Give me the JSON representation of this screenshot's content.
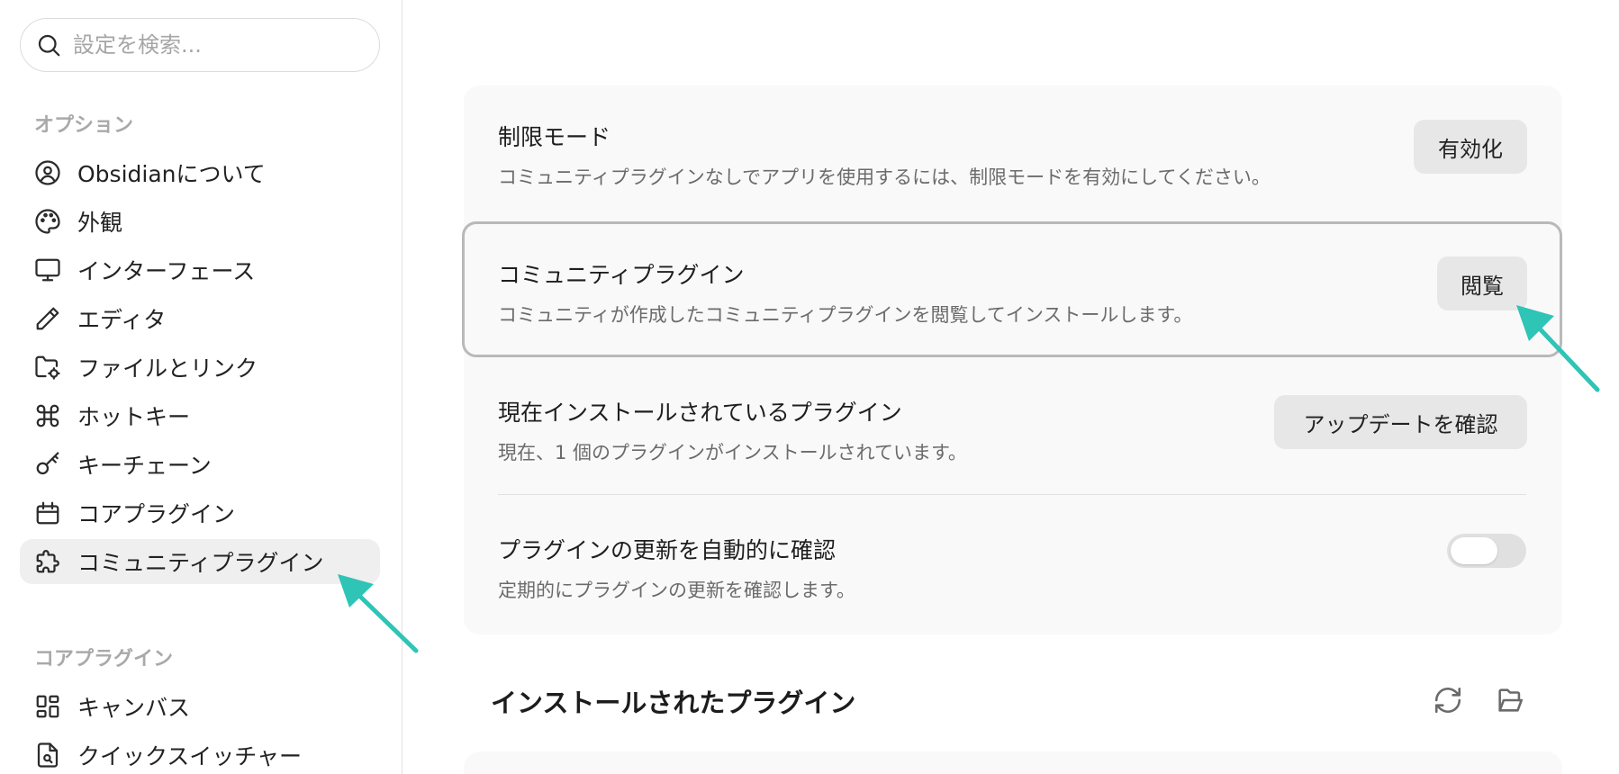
{
  "search": {
    "placeholder": "設定を検索..."
  },
  "sidebar": {
    "options_title": "オプション",
    "items": [
      {
        "label": "Obsidianについて",
        "icon": "user-circle-icon"
      },
      {
        "label": "外観",
        "icon": "palette-icon"
      },
      {
        "label": "インターフェース",
        "icon": "monitor-icon"
      },
      {
        "label": "エディタ",
        "icon": "pencil-icon"
      },
      {
        "label": "ファイルとリンク",
        "icon": "folder-cog-icon"
      },
      {
        "label": "ホットキー",
        "icon": "command-icon"
      },
      {
        "label": "キーチェーン",
        "icon": "key-icon"
      },
      {
        "label": "コアプラグイン",
        "icon": "calendar-icon"
      },
      {
        "label": "コミュニティプラグイン",
        "icon": "puzzle-icon",
        "active": true
      }
    ],
    "core_title": "コアプラグイン",
    "core_items": [
      {
        "label": "キャンバス",
        "icon": "layout-dashboard-icon"
      },
      {
        "label": "クイックスイッチャー",
        "icon": "file-search-icon"
      }
    ]
  },
  "settings": {
    "restricted_mode": {
      "name": "制限モード",
      "desc": "コミュニティプラグインなしでアプリを使用するには、制限モードを有効にしてください。",
      "button": "有効化"
    },
    "community_plugins": {
      "name": "コミュニティプラグイン",
      "desc": "コミュニティが作成したコミュニティプラグインを閲覧してインストールします。",
      "button": "閲覧"
    },
    "installed": {
      "name": "現在インストールされているプラグイン",
      "desc": "現在、1 個のプラグインがインストールされています。",
      "button": "アップデートを確認"
    },
    "auto_update": {
      "name": "プラグインの更新を自動的に確認",
      "desc": "定期的にプラグインの更新を確認します。",
      "enabled": false
    }
  },
  "installed_section": {
    "title": "インストールされたプラグイン"
  },
  "colors": {
    "annotation_arrow": "#2ec4b6",
    "active_bg": "#efefef",
    "card_bg": "#f9f9f9"
  }
}
